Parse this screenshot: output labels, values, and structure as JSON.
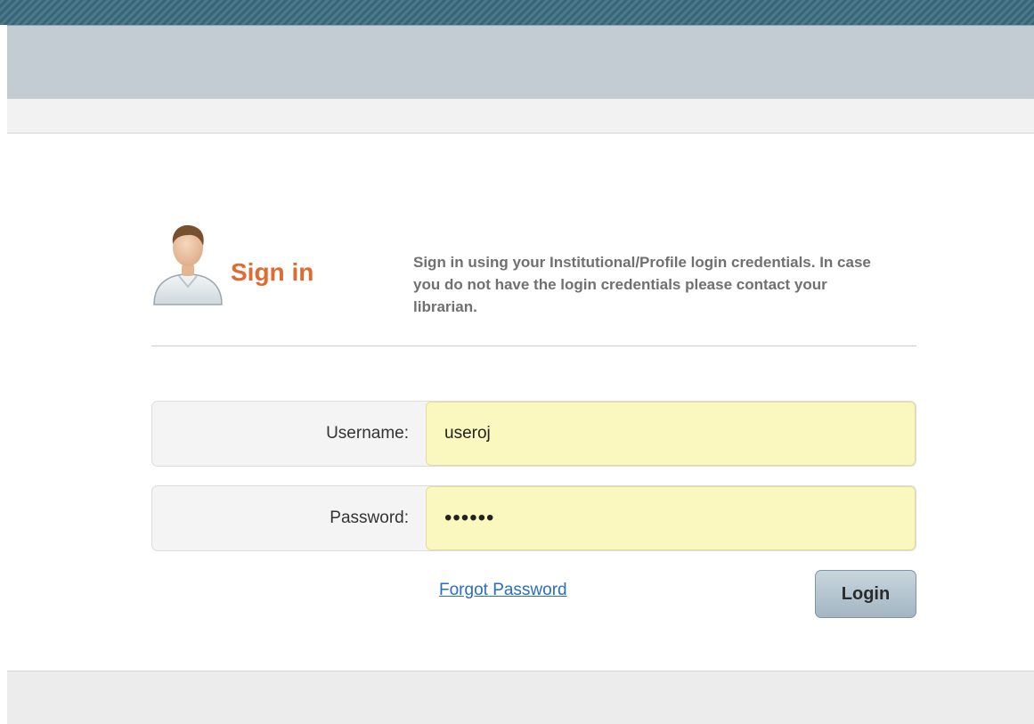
{
  "signin": {
    "title": "Sign in",
    "description": "Sign in using your Institutional/Profile login credentials. In case you do not have the login credentials please contact your librarian."
  },
  "form": {
    "username": {
      "label": "Username:",
      "value": "useroj"
    },
    "password": {
      "label": "Password:",
      "value": "••••••"
    },
    "forgot_password_label": "Forgot Password",
    "login_label": "Login"
  },
  "icons": {
    "avatar": "user-avatar-icon"
  },
  "colors": {
    "title_accent": "#e06a30",
    "input_background": "#fbf8bf",
    "link": "#2a6cc9",
    "header_band": "#c2ccd2"
  }
}
